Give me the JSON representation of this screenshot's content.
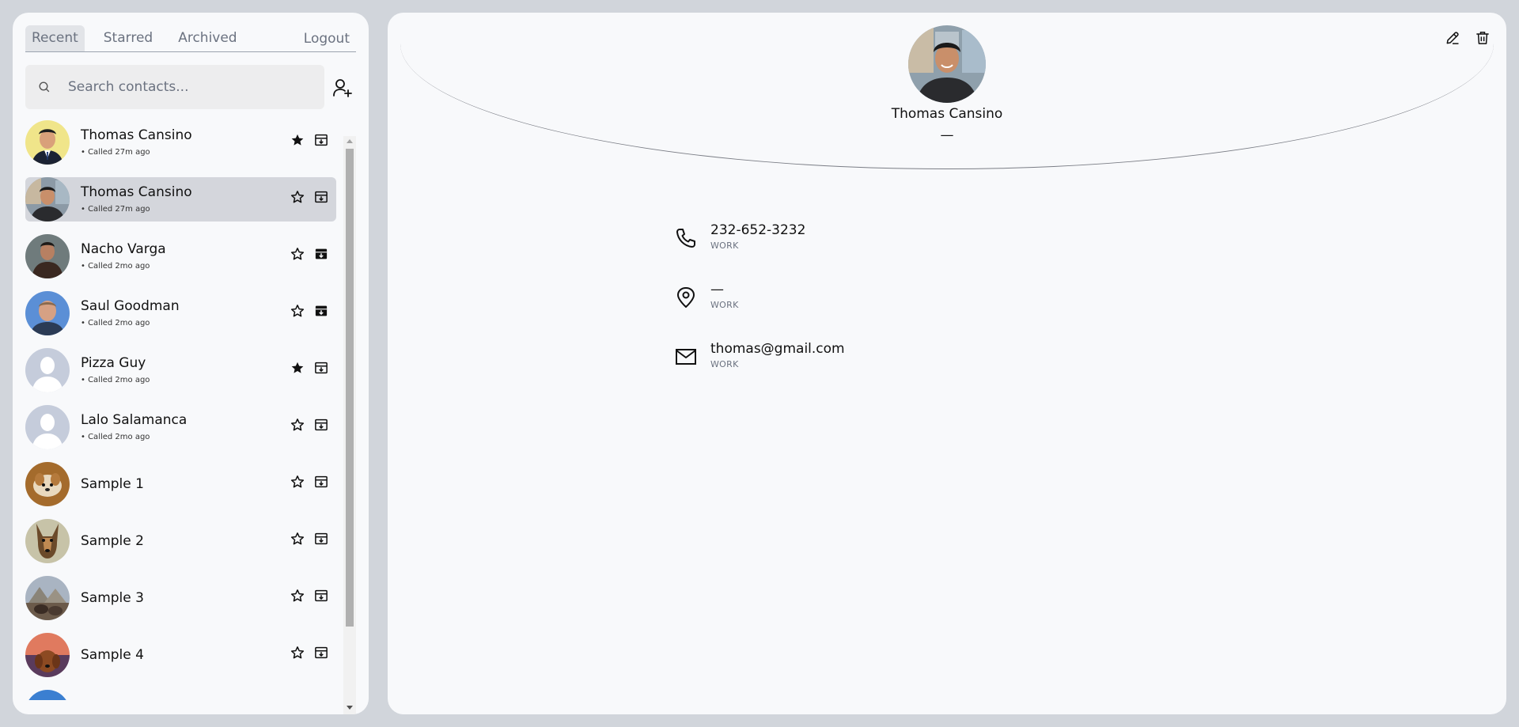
{
  "tabs": {
    "recent": "Recent",
    "starred": "Starred",
    "archived": "Archived",
    "logout": "Logout"
  },
  "search": {
    "placeholder": "Search contacts..."
  },
  "contacts": [
    {
      "name": "Thomas Cansino",
      "sub": "• Called 27m ago",
      "starred": true,
      "archived": false,
      "selected": false,
      "avatar": "photo-man-suit-yellow"
    },
    {
      "name": "Thomas Cansino",
      "sub": "• Called 27m ago",
      "starred": false,
      "archived": false,
      "selected": true,
      "avatar": "photo-man-dark-shirt"
    },
    {
      "name": "Nacho Varga",
      "sub": "• Called 2mo ago",
      "starred": false,
      "archived": true,
      "selected": false,
      "avatar": "photo-man-brown"
    },
    {
      "name": "Saul Goodman",
      "sub": "• Called 2mo ago",
      "starred": false,
      "archived": true,
      "selected": false,
      "avatar": "photo-man-blue-sky"
    },
    {
      "name": "Pizza Guy",
      "sub": "• Called 2mo ago",
      "starred": true,
      "archived": false,
      "selected": false,
      "avatar": "default-avatar"
    },
    {
      "name": "Lalo Salamanca",
      "sub": "• Called 2mo ago",
      "starred": false,
      "archived": false,
      "selected": false,
      "avatar": "default-avatar"
    },
    {
      "name": "Sample 1",
      "sub": "",
      "starred": false,
      "archived": false,
      "selected": false,
      "avatar": "photo-small-dog"
    },
    {
      "name": "Sample 2",
      "sub": "",
      "starred": false,
      "archived": false,
      "selected": false,
      "avatar": "photo-german-shepherd"
    },
    {
      "name": "Sample 3",
      "sub": "",
      "starred": false,
      "archived": false,
      "selected": false,
      "avatar": "photo-pyramids"
    },
    {
      "name": "Sample 4",
      "sub": "",
      "starred": false,
      "archived": false,
      "selected": false,
      "avatar": "photo-dog-sunset"
    }
  ],
  "detail": {
    "name": "Thomas Cansino",
    "subtitle": "—",
    "phone": {
      "value": "232-652-3232",
      "label": "WORK"
    },
    "address": {
      "value": "—",
      "label": "WORK"
    },
    "email": {
      "value": "thomas@gmail.com",
      "label": "WORK"
    }
  },
  "colors": {
    "page_bg": "#d1d5db",
    "panel_bg": "#f8f9fb",
    "selected_row": "#d4d6dc",
    "search_bg": "#ededee",
    "muted_text": "#6b7280"
  }
}
